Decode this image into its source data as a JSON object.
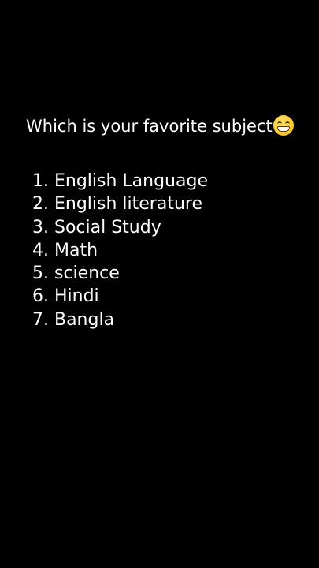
{
  "question": "Which is your favorite subject",
  "emoji": "grinning-face-icon",
  "subjects": [
    "1. English Language",
    "2. English literature",
    "3. Social Study",
    "4. Math",
    "5. science",
    "6. Hindi",
    "7. Bangla"
  ],
  "colors": {
    "background": "#000000",
    "text": "#ffffff",
    "emoji": "#ffcc33"
  }
}
